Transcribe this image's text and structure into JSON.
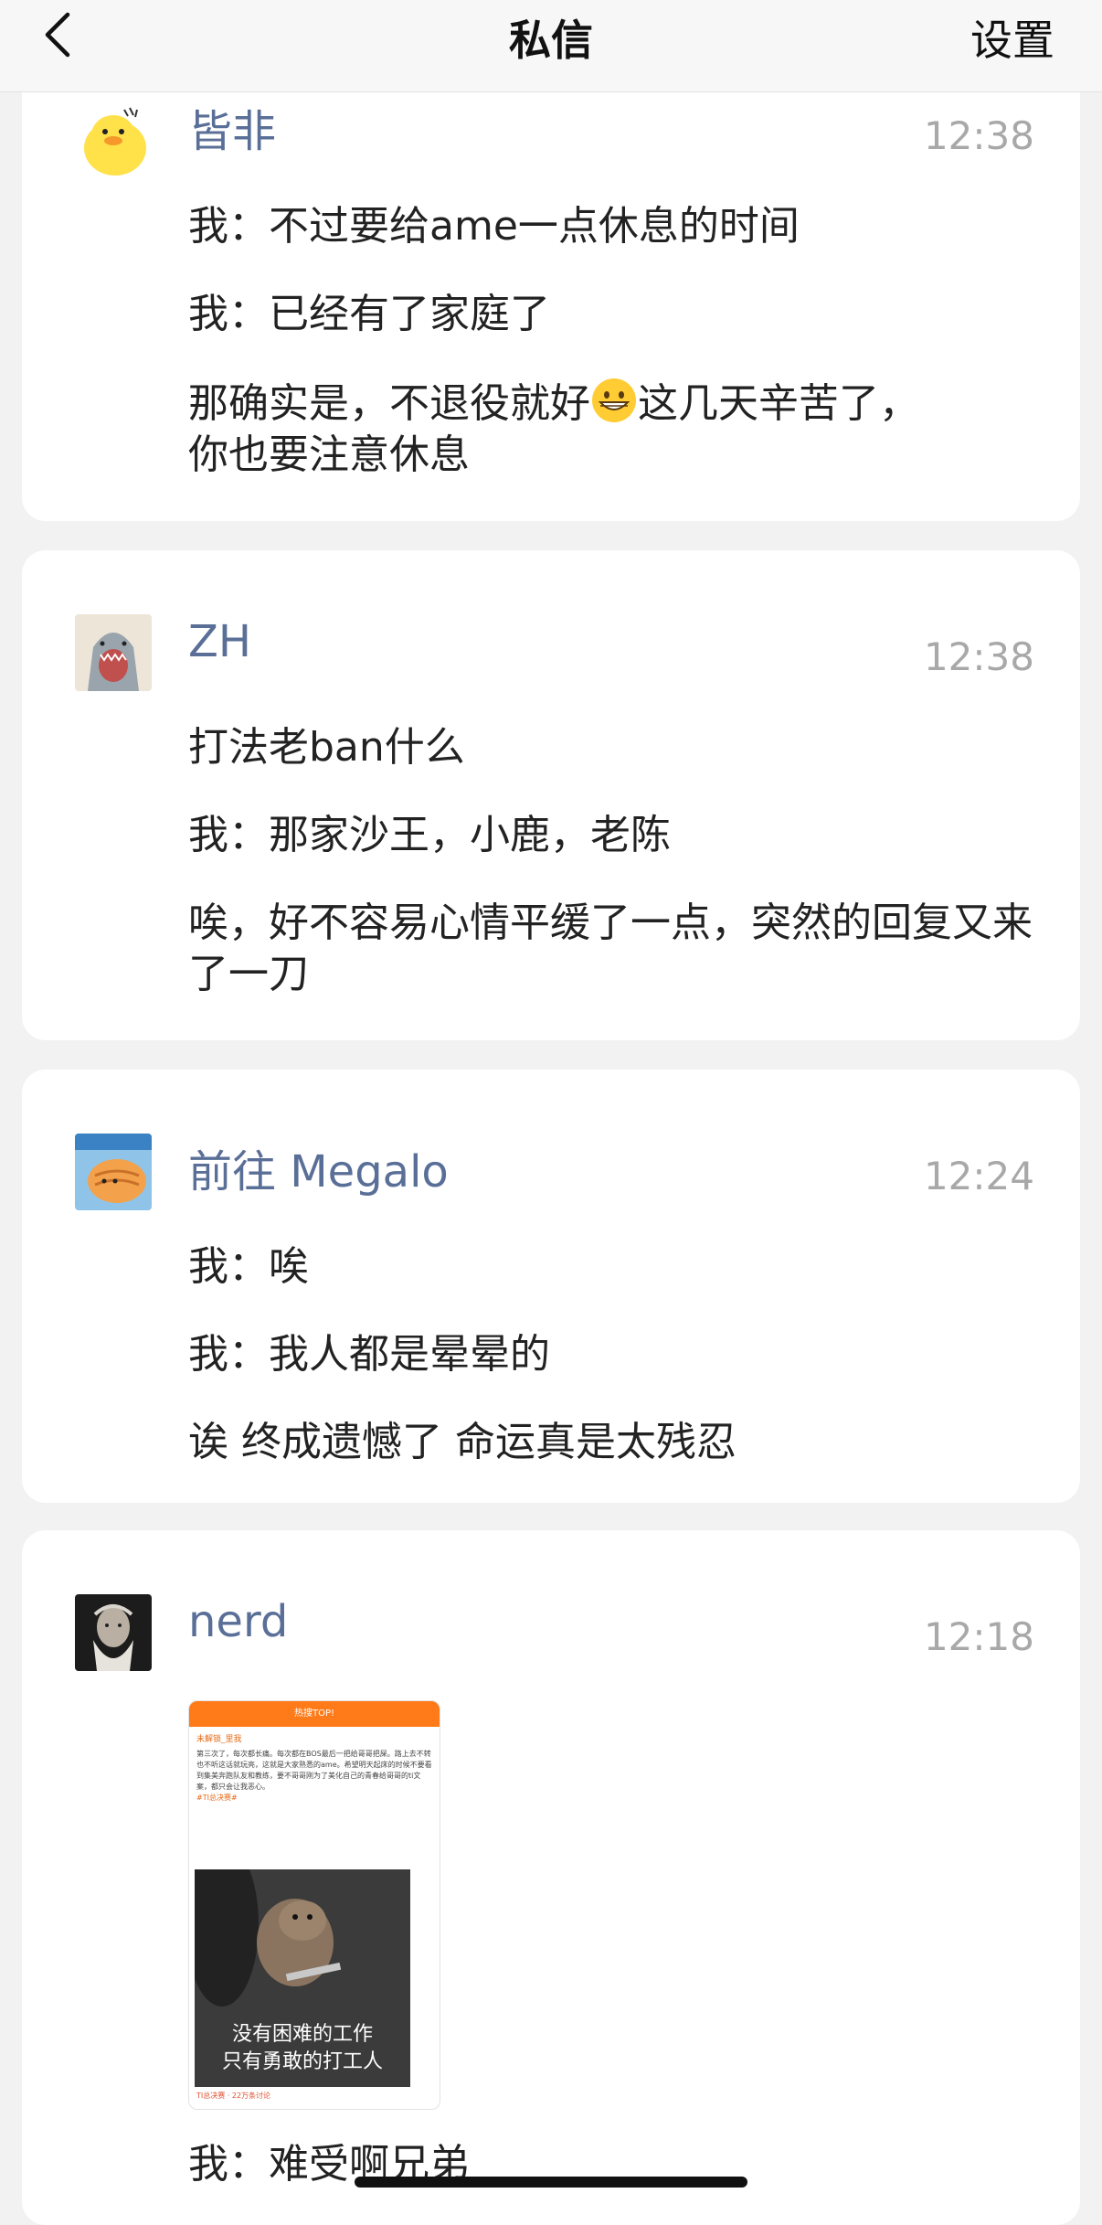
{
  "header": {
    "title": "私信",
    "settings_label": "设置"
  },
  "conversations": [
    {
      "name": "皆非",
      "time": "12:38",
      "messages": [
        "我：不过要给ame一点休息的时间",
        "我：已经有了家庭了"
      ],
      "reply_before_emoji": "那确实是，不退役就好",
      "reply_emoji": "grinning-face-emoji",
      "reply_after_emoji": "这几天辛苦了，你也要注意休息"
    },
    {
      "name": "ZH",
      "time": "12:38",
      "messages": [
        "打法老ban什么",
        "我：那家沙王，小鹿，老陈",
        "唉，好不容易心情平缓了一点，突然的回复又来了一刀"
      ]
    },
    {
      "name": "前往 Megalo",
      "time": "12:24",
      "messages": [
        "我：唉",
        "我：我人都是晕晕的",
        "诶 终成遗憾了 命运真是太残忍"
      ]
    },
    {
      "name": "nerd",
      "time": "12:18",
      "shared_image": {
        "header": "热搜TOP!",
        "user": "未解锁_里我",
        "body": "第三次了，每次都长痛。每次都在BOS最后一把给哥哥把屎。路上去不转也不听这话就玩亮，这就是大家熟悉的ame。希望明天起床的时候不要看到集美奔跑队友和教练，要不哥哥刚为了美化自己的青春给哥哥的ti文案，都只会让我恶心。",
        "hashtag": "#TI总决赛#",
        "caption_line1": "没有困难的工作",
        "caption_line2": "只有勇敢的打工人",
        "footer": "TI总决赛 · 22万条讨论"
      },
      "messages": [
        "我：难受啊兄弟"
      ]
    }
  ]
}
